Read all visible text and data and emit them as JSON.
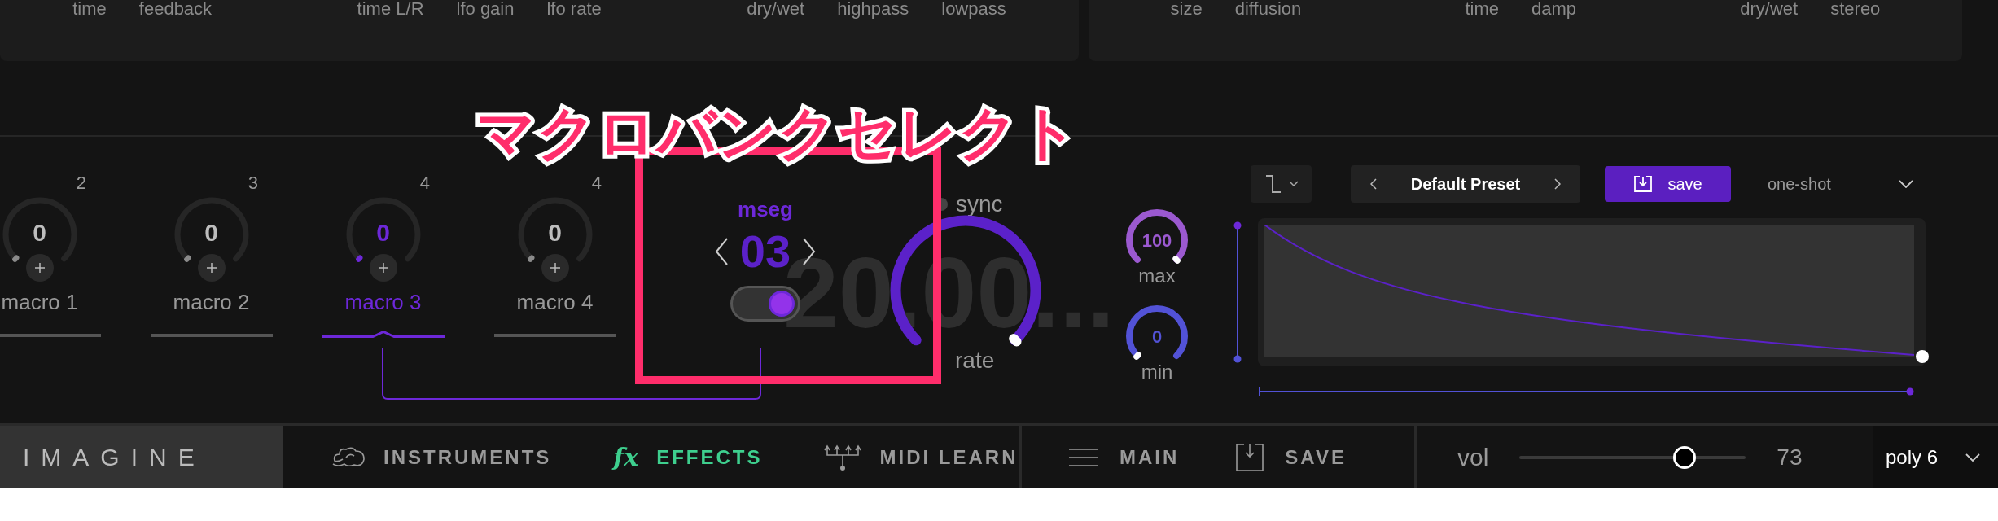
{
  "top_panels": [
    {
      "groups": [
        [
          "time",
          "feedback"
        ],
        [
          "time L/R",
          "lfo gain",
          "lfo rate"
        ],
        [
          "dry/wet",
          "highpass",
          "lowpass"
        ]
      ]
    },
    {
      "groups": [
        [
          "size",
          "diffusion"
        ],
        [
          "time",
          "damp"
        ],
        [
          "dry/wet",
          "stereo"
        ]
      ]
    }
  ],
  "annotation": {
    "text": "マクロバンクセレクト"
  },
  "macros": [
    {
      "label": "macro 1",
      "value": "0",
      "count": "2",
      "selected": false
    },
    {
      "label": "macro 2",
      "value": "0",
      "count": "3",
      "selected": false
    },
    {
      "label": "macro 3",
      "value": "0",
      "count": "4",
      "selected": true
    },
    {
      "label": "macro 4",
      "value": "0",
      "count": "4",
      "selected": false
    }
  ],
  "mseg": {
    "label": "mseg",
    "bank": "03",
    "on": true
  },
  "sync": {
    "label": "sync",
    "on": false
  },
  "rate": {
    "display": "20.00...",
    "label": "rate"
  },
  "range_knobs": [
    {
      "kind": "max",
      "value": "100",
      "label": "max"
    },
    {
      "kind": "min",
      "value": "0",
      "label": "min"
    }
  ],
  "editor": {
    "preset": "Default Preset",
    "save": "save",
    "mode": "one-shot"
  },
  "nav": {
    "logo": "IMAGINE",
    "tabs": [
      {
        "kind": "instruments",
        "label": "INSTRUMENTS",
        "selected": false
      },
      {
        "kind": "effects",
        "prefix": "fx",
        "label": "EFFECTS",
        "selected": true
      },
      {
        "kind": "midi",
        "label": "MIDI LEARN",
        "selected": false
      }
    ],
    "actions": [
      {
        "kind": "menu",
        "label": "MAIN"
      },
      {
        "kind": "save",
        "label": "SAVE"
      }
    ],
    "volume": {
      "label": "vol",
      "level": 0.73,
      "reading": "73"
    },
    "poly": "poly 6"
  }
}
